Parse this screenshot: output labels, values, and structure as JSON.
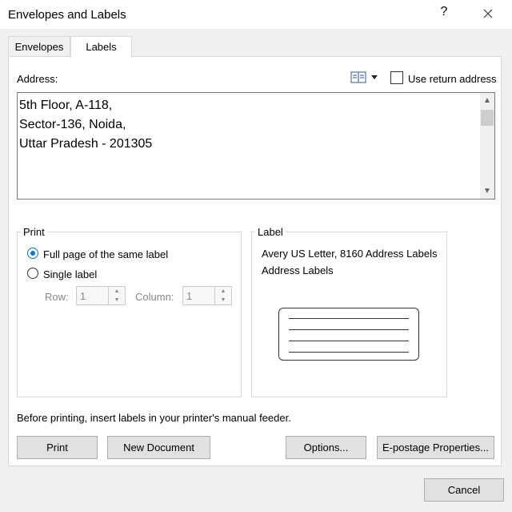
{
  "window": {
    "title": "Envelopes and Labels",
    "help": "?",
    "close_icon": "close-icon"
  },
  "tabs": [
    {
      "label": "Envelopes",
      "mnemonic_index": 0,
      "selected": false
    },
    {
      "label": "Labels",
      "mnemonic_index": 0,
      "selected": true
    }
  ],
  "address": {
    "label": "Address:",
    "text": "5th Floor, A-118,\nSector-136, Noida,\nUttar Pradesh - 201305",
    "address_book_icon": "address-book-icon",
    "use_return_address_label": "Use return address",
    "use_return_address_checked": false
  },
  "print_group": {
    "legend": "Print",
    "full_page_label": "Full page of the same label",
    "single_label_label": "Single label",
    "selected": "full_page",
    "row_label": "Row:",
    "row_value": "1",
    "column_label": "Column:",
    "column_value": "1"
  },
  "label_group": {
    "legend": "Label",
    "product": "Avery US Letter, 8160 Address Labels",
    "type": "Address Labels"
  },
  "instruction": "Before printing, insert labels in your printer's manual feeder.",
  "buttons": {
    "print": "Print",
    "new_document": "New Document",
    "options": "Options...",
    "epostage": "E-postage Properties...",
    "cancel": "Cancel"
  },
  "colors": {
    "accent": "#0078d7"
  }
}
